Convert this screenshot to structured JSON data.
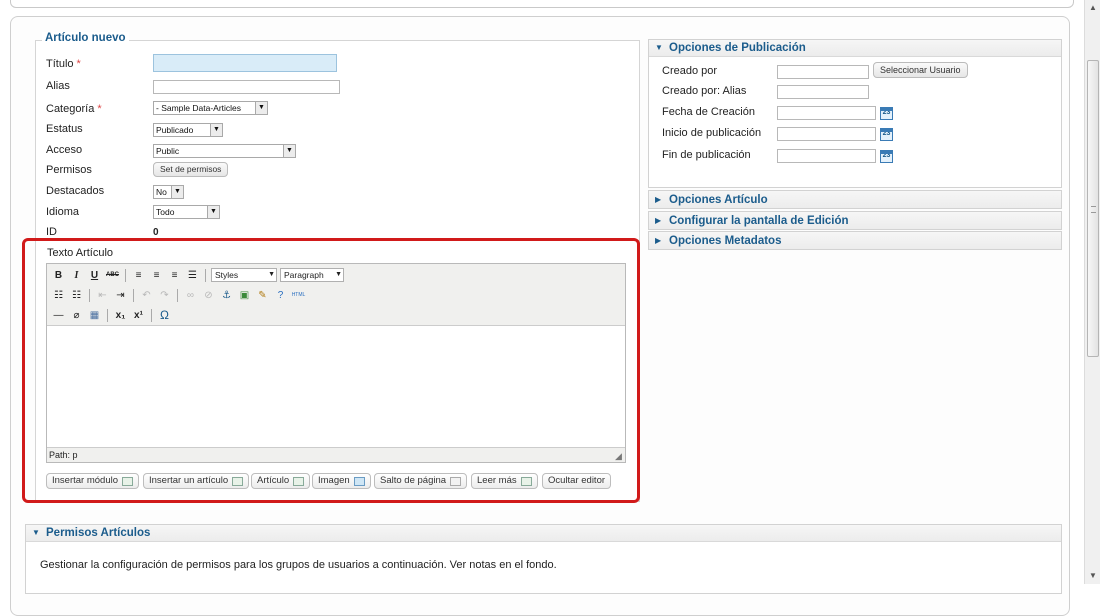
{
  "details": {
    "legend": "Artículo nuevo",
    "titulo_label": "Título",
    "alias_label": "Alias",
    "categoria_label": "Categoría",
    "categoria_value": "- Sample Data-Articles",
    "estatus_label": "Estatus",
    "estatus_value": "Publicado",
    "acceso_label": "Acceso",
    "acceso_value": "Public",
    "permisos_label": "Permisos",
    "permisos_button": "Set de permisos",
    "destacados_label": "Destacados",
    "destacados_value": "No",
    "idioma_label": "Idioma",
    "idioma_value": "Todo",
    "id_label": "ID",
    "id_value": "0",
    "required_mark": "*"
  },
  "editor": {
    "label": "Texto Artículo",
    "styles_select": "Styles",
    "format_select": "Paragraph",
    "path": "Path: p",
    "buttons": {
      "insert_module": "Insertar módulo",
      "insert_article": "Insertar un artículo",
      "article": "Artículo",
      "image": "Imagen",
      "page_break": "Salto de página",
      "read_more": "Leer más",
      "toggle_editor": "Ocultar editor"
    }
  },
  "publishing": {
    "title": "Opciones de Publicación",
    "created_by_label": "Creado por",
    "select_user_button": "Seleccionar Usuario",
    "created_by_alias_label": "Creado por: Alias",
    "created_date_label": "Fecha de Creación",
    "publish_up_label": "Inicio de publicación",
    "publish_down_label": "Fin de publicación",
    "calendar_day": "23"
  },
  "accordions": {
    "article_options": "Opciones Artículo",
    "edit_screen": "Configurar la pantalla de Edición",
    "metadata": "Opciones Metadatos"
  },
  "permissions": {
    "title": "Permisos Artículos",
    "description": "Gestionar la configuración de permisos para los grupos de usuarios a continuación. Ver notas en el fondo."
  },
  "colors": {
    "accent": "#1b5c8c",
    "highlight_box": "#d11a1a",
    "required": "#dd4444"
  }
}
